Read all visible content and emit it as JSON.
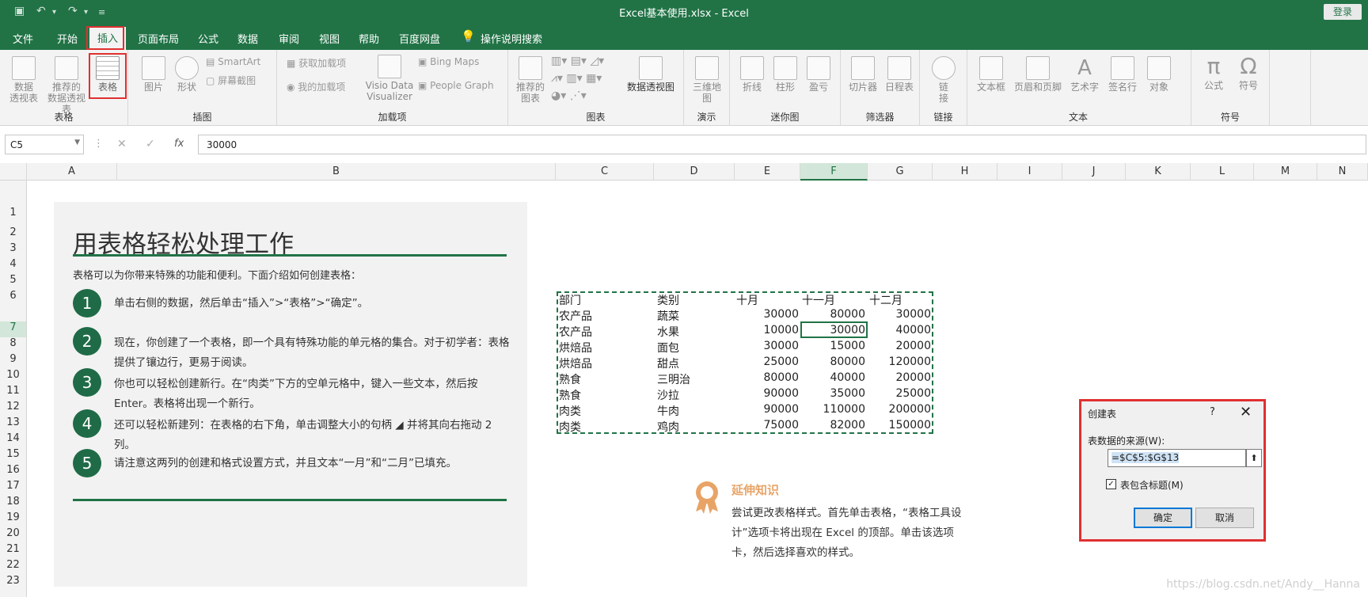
{
  "window": {
    "title": "Excel基本使用.xlsx  -  Excel",
    "login": "登录",
    "quick_access": [
      "save-icon",
      "undo-icon",
      "redo-icon",
      "customize-icon"
    ]
  },
  "tabs": [
    "文件",
    "开始",
    "插入",
    "页面布局",
    "公式",
    "数据",
    "审阅",
    "视图",
    "帮助",
    "百度网盘",
    "操作说明搜索"
  ],
  "active_tab": "插入",
  "ribbon": {
    "groups": {
      "tables": "表格",
      "illustrations": "插图",
      "addins": "加载项",
      "charts": "图表",
      "tours": "演示",
      "sparklines": "迷你图",
      "filters": "筛选器",
      "links": "链接",
      "text": "文本",
      "symbols": "符号"
    },
    "buttons": {
      "pivot1": "数据",
      "pivot2": "透视表",
      "rec_pivot1": "推荐的",
      "rec_pivot2": "数据透视表",
      "table": "表格",
      "pictures": "图片",
      "shapes": "形状",
      "smartart": "SmartArt",
      "screenshot": "屏幕截图",
      "get_addins": "获取加载项",
      "my_addins": "我的加载项",
      "visio1": "Visio Data",
      "visio2": "Visualizer",
      "bing_maps": "Bing Maps",
      "people_graph": "People Graph",
      "rec_charts1": "推荐的",
      "rec_charts2": "图表",
      "pivot_chart": "数据透视图",
      "map3d1": "三维地",
      "map3d2": "图",
      "line": "折线",
      "column": "柱形",
      "winloss": "盈亏",
      "slicer": "切片器",
      "timeline": "日程表",
      "link": "链",
      "link2": "接",
      "textbox": "文本框",
      "header_footer": "页眉和页脚",
      "wordart": "艺术字",
      "signature": "签名行",
      "object": "对象",
      "equation": "公式",
      "symbol": "符号"
    }
  },
  "formula_bar": {
    "name_box": "C5",
    "value": "30000"
  },
  "columns": [
    "A",
    "B",
    "C",
    "D",
    "E",
    "F",
    "G",
    "H",
    "I",
    "J",
    "K",
    "L",
    "M",
    "N"
  ],
  "selected_column": "F",
  "rows": [
    "1",
    "2",
    "3",
    "4",
    "5",
    "6",
    "7",
    "8",
    "9",
    "10",
    "11",
    "12",
    "13",
    "14",
    "15",
    "16",
    "17",
    "18",
    "19",
    "20",
    "21",
    "22",
    "23"
  ],
  "selected_row": "7",
  "panel": {
    "title": "用表格轻松处理工作",
    "intro": "表格可以为你带来特殊的功能和便利。下面介绍如何创建表格：",
    "steps": [
      {
        "num": "1",
        "text": "单击右侧的数据，然后单击“插入”>“表格”>“确定”。"
      },
      {
        "num": "2",
        "text": "现在，你创建了一个表格，即一个具有特殊功能的单元格的集合。对于初学者：表格提供了镶边行，更易于阅读。"
      },
      {
        "num": "3",
        "text": "你也可以轻松创建新行。在“肉类”下方的空单元格中，键入一些文本，然后按 Enter。表格将出现一个新行。"
      },
      {
        "num": "4",
        "text": "还可以轻松新建列：在表格的右下角，单击调整大小的句柄 ◢ 并将其向右拖动 2 列。"
      },
      {
        "num": "5",
        "text": "请注意这两列的创建和格式设置方式，并且文本“一月”和“二月”已填充。"
      }
    ]
  },
  "sheet_table": {
    "headers": [
      "部门",
      "类别",
      "十月",
      "十一月",
      "十二月"
    ],
    "rows": [
      [
        "农产品",
        "蔬菜",
        "30000",
        "80000",
        "30000"
      ],
      [
        "农产品",
        "水果",
        "10000",
        "30000",
        "40000"
      ],
      [
        "烘焙品",
        "面包",
        "30000",
        "15000",
        "20000"
      ],
      [
        "烘焙品",
        "甜点",
        "25000",
        "80000",
        "120000"
      ],
      [
        "熟食",
        "三明治",
        "80000",
        "40000",
        "20000"
      ],
      [
        "熟食",
        "沙拉",
        "90000",
        "35000",
        "25000"
      ],
      [
        "肉类",
        "牛肉",
        "90000",
        "110000",
        "200000"
      ],
      [
        "肉类",
        "鸡肉",
        "75000",
        "82000",
        "150000"
      ]
    ]
  },
  "extend": {
    "title": "延伸知识",
    "text": "尝试更改表格样式。首先单击表格，“表格工具设计”选项卡将出现在 Excel 的顶部。单击该选项卡，然后选择喜欢的样式。"
  },
  "dialog": {
    "title": "创建表",
    "help": "?",
    "close": "✕",
    "source_label": "表数据的来源(W):",
    "source_value": "=$C$5:$G$13",
    "has_headers": "表包含标题(M)",
    "ok": "确定",
    "cancel": "取消"
  },
  "watermark": "https://blog.csdn.net/Andy__Hanna"
}
